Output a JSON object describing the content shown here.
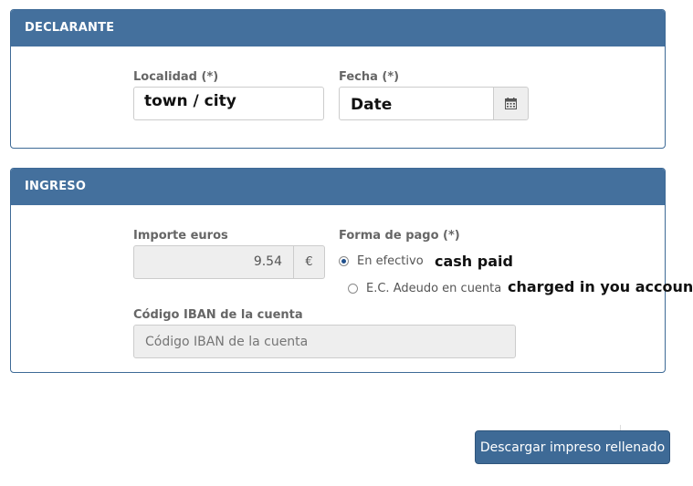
{
  "declarante": {
    "header": "DECLARANTE",
    "localidad_label": "Localidad (*)",
    "localidad_value": "town / city",
    "fecha_label": "Fecha (*)",
    "fecha_value": "Date",
    "calendar_icon": "calendar-icon"
  },
  "ingreso": {
    "header": "INGRESO",
    "importe_label": "Importe euros",
    "importe_value": "9.54",
    "currency_symbol": "€",
    "forma_pago_label": "Forma de pago (*)",
    "option_efectivo": "En efectivo",
    "option_efectivo_note": "cash paid",
    "option_adeudo": "E.C. Adeudo en cuenta",
    "option_adeudo_note": "charged in you account",
    "selected_option": "En efectivo",
    "iban_label": "Código IBAN de la cuenta",
    "iban_placeholder": "Código IBAN de la cuenta"
  },
  "actions": {
    "download_label": "Descargar impreso rellenado"
  },
  "colors": {
    "header_bg": "#44709d",
    "button_bg": "#3e6a96",
    "readonly_bg": "#eeeeee"
  }
}
